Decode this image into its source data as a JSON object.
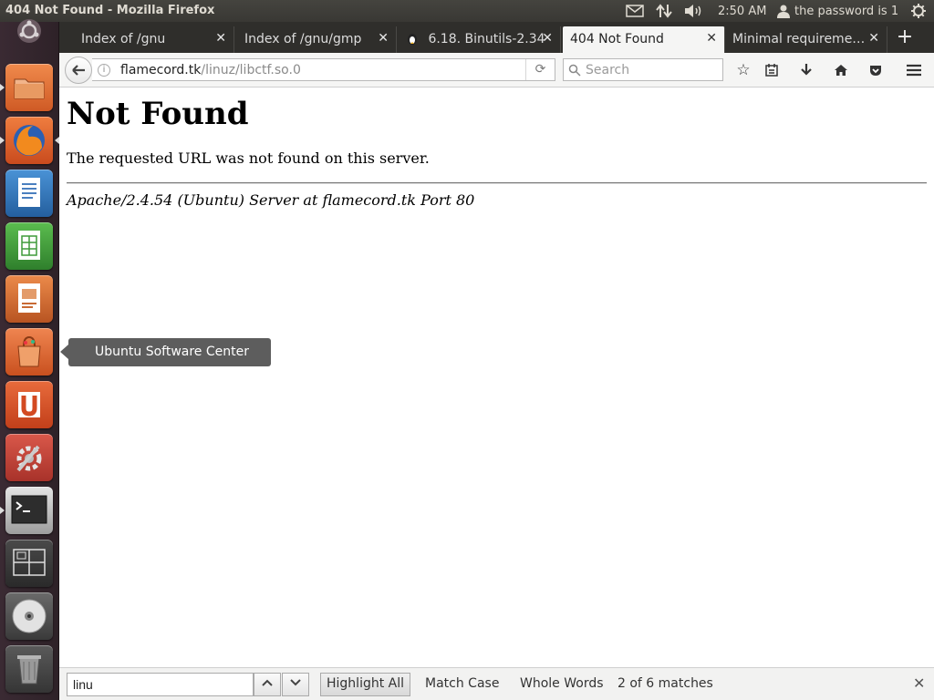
{
  "top_panel": {
    "window_title": "404 Not Found - Mozilla Firefox",
    "clock": "2:50 AM",
    "user_label": "the password is 1"
  },
  "launcher": {
    "items": [
      {
        "name": "dash-home",
        "color": "#5a4a52"
      },
      {
        "name": "files",
        "color": "#e0763a"
      },
      {
        "name": "firefox",
        "color": "#d9602a"
      },
      {
        "name": "libreoffice-writer",
        "color": "#2f76b8"
      },
      {
        "name": "libreoffice-calc",
        "color": "#3f9a3a"
      },
      {
        "name": "libreoffice-impress",
        "color": "#d1692c"
      },
      {
        "name": "software-center",
        "color": "#d9622b"
      },
      {
        "name": "ubuntu-one",
        "color": "#d9532b"
      },
      {
        "name": "system-settings",
        "color": "#c94e3a"
      },
      {
        "name": "terminal",
        "color": "#3a3a3a"
      },
      {
        "name": "workspace-switcher",
        "color": "#3a3a3a"
      },
      {
        "name": "dvd",
        "color": "#bdbdbd"
      },
      {
        "name": "trash",
        "color": "#6d6d6d"
      }
    ],
    "tooltip": "Ubuntu Software Center"
  },
  "tabs": [
    {
      "label": "Index of /gnu"
    },
    {
      "label": "Index of /gnu/gmp"
    },
    {
      "label": "6.18. Binutils-2.34"
    },
    {
      "label": "404 Not Found"
    },
    {
      "label": "Minimal requireme…"
    }
  ],
  "nav": {
    "url_domain": "flamecord.tk",
    "url_path": "/linuz/libctf.so.0",
    "search_placeholder": "Search"
  },
  "page": {
    "heading": "Not Found",
    "message": "The requested URL was not found on this server.",
    "signature": "Apache/2.4.54 (Ubuntu) Server at flamecord.tk Port 80"
  },
  "find_bar": {
    "query": "linu",
    "highlight_all": "Highlight All",
    "match_case": "Match Case",
    "whole_words": "Whole Words",
    "status": "2 of 6 matches"
  }
}
